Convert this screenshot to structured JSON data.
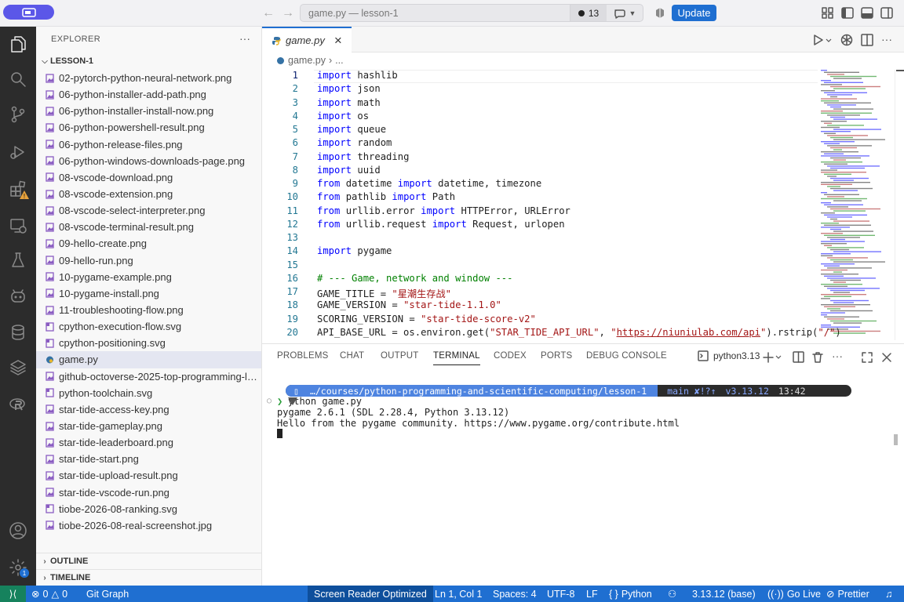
{
  "titlebar": {
    "command_center": "game.py — lesson-1",
    "problems_count": "13",
    "update_label": "Update"
  },
  "explorer": {
    "title": "EXPLORER",
    "folder": "LESSON-1",
    "files": [
      {
        "name": "02-pytorch-python-neural-network.png",
        "kind": "png"
      },
      {
        "name": "06-python-installer-add-path.png",
        "kind": "png"
      },
      {
        "name": "06-python-installer-install-now.png",
        "kind": "png"
      },
      {
        "name": "06-python-powershell-result.png",
        "kind": "png"
      },
      {
        "name": "06-python-release-files.png",
        "kind": "png"
      },
      {
        "name": "06-python-windows-downloads-page.png",
        "kind": "png"
      },
      {
        "name": "08-vscode-download.png",
        "kind": "png"
      },
      {
        "name": "08-vscode-extension.png",
        "kind": "png"
      },
      {
        "name": "08-vscode-select-interpreter.png",
        "kind": "png"
      },
      {
        "name": "08-vscode-terminal-result.png",
        "kind": "png"
      },
      {
        "name": "09-hello-create.png",
        "kind": "png"
      },
      {
        "name": "09-hello-run.png",
        "kind": "png"
      },
      {
        "name": "10-pygame-example.png",
        "kind": "png"
      },
      {
        "name": "10-pygame-install.png",
        "kind": "png"
      },
      {
        "name": "11-troubleshooting-flow.png",
        "kind": "png"
      },
      {
        "name": "cpython-execution-flow.svg",
        "kind": "svg"
      },
      {
        "name": "cpython-positioning.svg",
        "kind": "svg"
      },
      {
        "name": "game.py",
        "kind": "py",
        "selected": true
      },
      {
        "name": "github-octoverse-2025-top-programming-languages.png",
        "kind": "png"
      },
      {
        "name": "python-toolchain.svg",
        "kind": "svg"
      },
      {
        "name": "star-tide-access-key.png",
        "kind": "png"
      },
      {
        "name": "star-tide-gameplay.png",
        "kind": "png"
      },
      {
        "name": "star-tide-leaderboard.png",
        "kind": "png"
      },
      {
        "name": "star-tide-start.png",
        "kind": "png"
      },
      {
        "name": "star-tide-upload-result.png",
        "kind": "png"
      },
      {
        "name": "star-tide-vscode-run.png",
        "kind": "png"
      },
      {
        "name": "tiobe-2026-08-ranking.svg",
        "kind": "svg"
      },
      {
        "name": "tiobe-2026-08-real-screenshot.jpg",
        "kind": "png"
      }
    ],
    "outline_label": "OUTLINE",
    "timeline_label": "TIMELINE"
  },
  "editor": {
    "tab_label": "game.py",
    "breadcrumb_file": "game.py",
    "breadcrumb_more": "...",
    "lines": [
      [
        [
          "kw",
          "import"
        ],
        [
          "",
          "hashlib"
        ]
      ],
      [
        [
          "kw",
          "import"
        ],
        [
          "",
          "json"
        ]
      ],
      [
        [
          "kw",
          "import"
        ],
        [
          "",
          "math"
        ]
      ],
      [
        [
          "kw",
          "import"
        ],
        [
          "",
          "os"
        ]
      ],
      [
        [
          "kw",
          "import"
        ],
        [
          "",
          "queue"
        ]
      ],
      [
        [
          "kw",
          "import"
        ],
        [
          "",
          "random"
        ]
      ],
      [
        [
          "kw",
          "import"
        ],
        [
          "",
          "threading"
        ]
      ],
      [
        [
          "kw",
          "import"
        ],
        [
          "",
          "uuid"
        ]
      ],
      [
        [
          "kw",
          "from"
        ],
        [
          "",
          "datetime"
        ],
        [
          "kw",
          "import"
        ],
        [
          "",
          "datetime, timezone"
        ]
      ],
      [
        [
          "kw",
          "from"
        ],
        [
          "",
          "pathlib"
        ],
        [
          "kw",
          "import"
        ],
        [
          "",
          "Path"
        ]
      ],
      [
        [
          "kw",
          "from"
        ],
        [
          "",
          "urllib.error"
        ],
        [
          "kw",
          "import"
        ],
        [
          "",
          "HTTPError, URLError"
        ]
      ],
      [
        [
          "kw",
          "from"
        ],
        [
          "",
          "urllib.request"
        ],
        [
          "kw",
          "import"
        ],
        [
          "",
          "Request, urlopen"
        ]
      ],
      [],
      [
        [
          "kw",
          "import"
        ],
        [
          "",
          "pygame"
        ]
      ],
      [],
      [
        [
          "cm",
          "# --- Game, network and window ---"
        ]
      ],
      [
        [
          "",
          "GAME_TITLE = "
        ],
        [
          "st",
          "\"星潮生存战\""
        ]
      ],
      [
        [
          "",
          "GAME_VERSION = "
        ],
        [
          "st",
          "\"star-tide-1.1.0\""
        ]
      ],
      [
        [
          "",
          "SCORING_VERSION = "
        ],
        [
          "st",
          "\"star-tide-score-v2\""
        ]
      ],
      [
        [
          "",
          "API_BASE_URL = os.environ.get("
        ],
        [
          "st",
          "\"STAR_TIDE_API_URL\""
        ],
        [
          "",
          ", "
        ],
        [
          "st",
          "\""
        ],
        [
          "url",
          "https://niuniulab.com/api"
        ],
        [
          "st",
          "\""
        ],
        [
          "",
          ").rstrip("
        ],
        [
          "st",
          "\"/\""
        ],
        [
          "",
          ")"
        ]
      ]
    ]
  },
  "panel": {
    "tabs": [
      "PROBLEMS",
      "CHAT",
      "OUTPUT",
      "TERMINAL",
      "CODEX",
      "PORTS",
      "DEBUG CONSOLE"
    ],
    "active_tab": "TERMINAL",
    "terminal_name": "python3.13",
    "prompt_path": "…/courses/python-programming-and-scientific-computing/lesson-1",
    "prompt_git": " main ✘!?↑",
    "prompt_python": " v3.13.12",
    "prompt_time": " 13:42",
    "command": "ython game.py",
    "output": [
      "pygame 2.6.1 (SDL 2.28.4, Python 3.13.12)",
      "Hello from the pygame community. https://www.pygame.org/contribute.html"
    ]
  },
  "statusbar": {
    "errors": "0",
    "warnings": "0",
    "git_graph": "Git Graph",
    "screen_reader": "Screen Reader Optimized",
    "position": "Ln 1, Col 1",
    "spaces": "Spaces: 4",
    "encoding": "UTF-8",
    "eol": "LF",
    "language": "Python",
    "interpreter": "3.13.12 (base)",
    "go_live": "Go Live",
    "prettier": "Prettier"
  },
  "colors": {
    "accent": "#1f6fd1",
    "menu_pill": "#5b57e8",
    "keyword": "#0000ff",
    "string": "#a31515",
    "comment": "#008000",
    "activity_bar": "#2c2c2c"
  }
}
